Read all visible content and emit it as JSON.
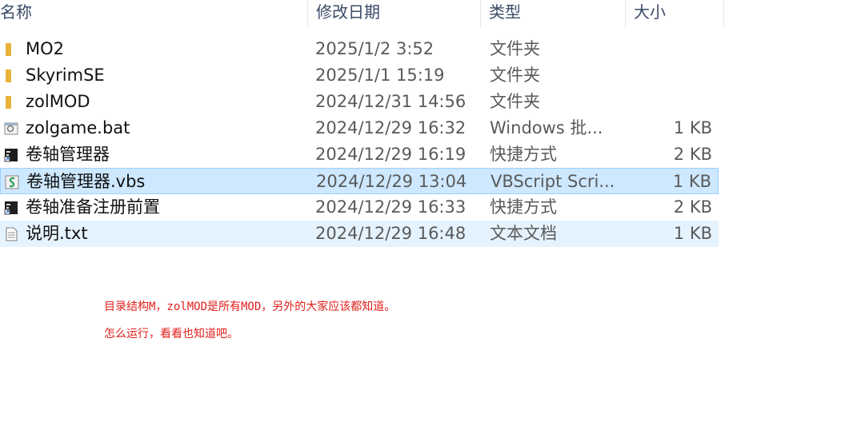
{
  "columns": {
    "name": "名称",
    "date": "修改日期",
    "type": "类型",
    "size": "大小"
  },
  "files": [
    {
      "name": "MO2",
      "date": "2025/1/2 3:52",
      "type": "文件夹",
      "size": "",
      "icon": "folder-icon"
    },
    {
      "name": "SkyrimSE",
      "date": "2025/1/1 15:19",
      "type": "文件夹",
      "size": "",
      "icon": "folder-icon"
    },
    {
      "name": "zolMOD",
      "date": "2024/12/31 14:56",
      "type": "文件夹",
      "size": "",
      "icon": "folder-icon"
    },
    {
      "name": "zolgame.bat",
      "date": "2024/12/29 16:32",
      "type": "Windows 批...",
      "size": "1 KB",
      "icon": "batch-file-icon"
    },
    {
      "name": "卷轴管理器",
      "date": "2024/12/29 16:19",
      "type": "快捷方式",
      "size": "2 KB",
      "icon": "shortcut-icon"
    },
    {
      "name": "卷轴管理器.vbs",
      "date": "2024/12/29 13:04",
      "type": "VBScript Scri...",
      "size": "1 KB",
      "icon": "vbscript-file-icon",
      "state": "selected"
    },
    {
      "name": "卷轴准备注册前置",
      "date": "2024/12/29 16:33",
      "type": "快捷方式",
      "size": "2 KB",
      "icon": "shortcut-icon"
    },
    {
      "name": "说明.txt",
      "date": "2024/12/29 16:48",
      "type": "文本文档",
      "size": "1 KB",
      "icon": "text-file-icon",
      "state": "hover"
    }
  ],
  "notes": {
    "line1": "目录结构M，zolMOD是所有MOD，另外的大家应该都知道。",
    "line2": "怎么运行，看看也知道吧。"
  },
  "colors": {
    "selected_bg": "#cde8ff",
    "hover_bg": "#e5f3ff",
    "note": "#e0201c",
    "folder": "#e8b339"
  }
}
